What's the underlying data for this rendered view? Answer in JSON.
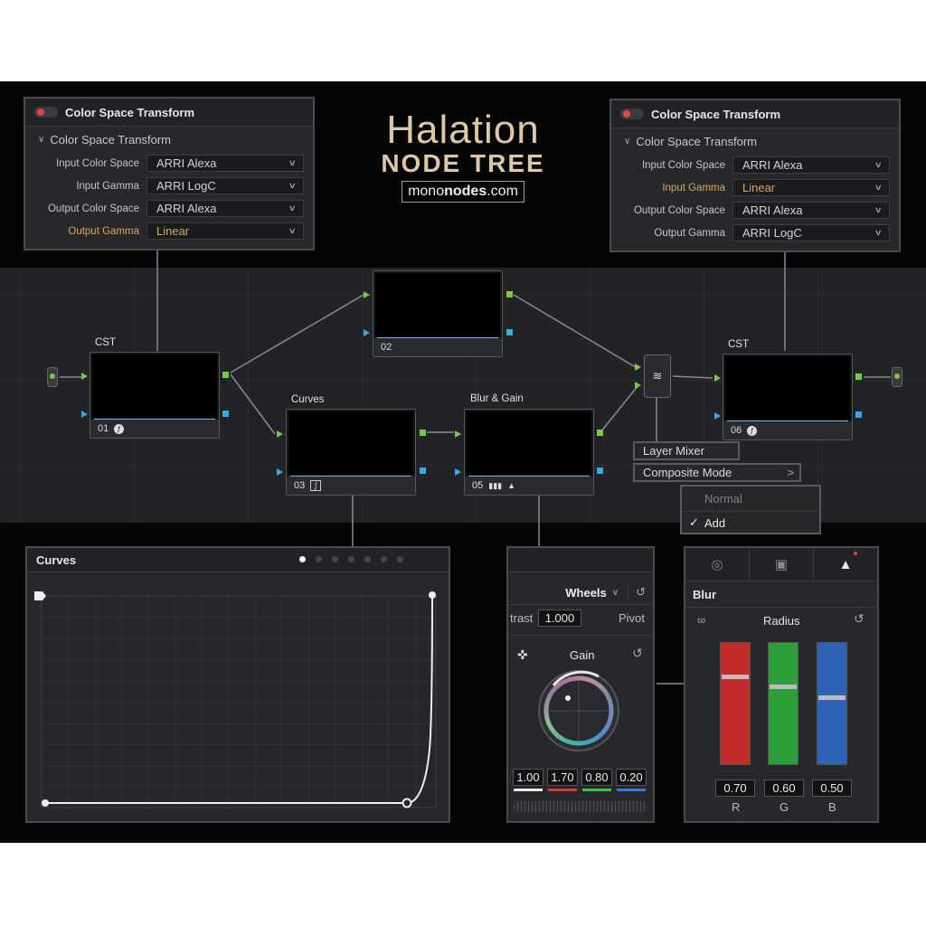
{
  "branding": {
    "line1": "Halation",
    "line2": "NODE TREE",
    "site_pre": "mono",
    "site_bold": "nodes",
    "site_post": ".com"
  },
  "cst_left": {
    "title": "Color Space Transform",
    "section": "Color Space Transform",
    "rows": [
      {
        "label": "Input Color Space",
        "value": "ARRI Alexa"
      },
      {
        "label": "Input Gamma",
        "value": "ARRI LogC"
      },
      {
        "label": "Output Color Space",
        "value": "ARRI Alexa"
      },
      {
        "label": "Output Gamma",
        "value": "Linear"
      }
    ]
  },
  "cst_right": {
    "title": "Color Space Transform",
    "section": "Color Space Transform",
    "rows": [
      {
        "label": "Input Color Space",
        "value": "ARRI Alexa"
      },
      {
        "label": "Input Gamma",
        "value": "Linear"
      },
      {
        "label": "Output Color Space",
        "value": "ARRI Alexa"
      },
      {
        "label": "Output Gamma",
        "value": "ARRI LogC"
      }
    ]
  },
  "highlight_color": "#d9a85b",
  "nodes": {
    "n01": {
      "label": "CST",
      "num": "01"
    },
    "n02": {
      "label": "",
      "num": "02"
    },
    "n03": {
      "label": "Curves",
      "num": "03"
    },
    "n05": {
      "label": "Blur & Gain",
      "num": "05"
    },
    "n06": {
      "label": "CST",
      "num": "06"
    }
  },
  "mixer_menu": {
    "layer_mixer": "Layer Mixer",
    "composite_mode": "Composite Mode",
    "options": [
      "Normal",
      "Add"
    ],
    "selected": "Add"
  },
  "curves": {
    "title": "Curves",
    "pages": 7,
    "active_page": 1
  },
  "wheels": {
    "mode": "Wheels",
    "contrast_label": "trast",
    "contrast_value": "1.000",
    "pivot_label": "Pivot",
    "wheel_label": "Gain",
    "values": [
      "1.00",
      "1.70",
      "0.80",
      "0.20"
    ]
  },
  "blur": {
    "title": "Blur",
    "radius_label": "Radius",
    "values": [
      "0.70",
      "0.60",
      "0.50"
    ],
    "channels": [
      "R",
      "G",
      "B"
    ],
    "levels": [
      0.7,
      0.6,
      0.5
    ]
  }
}
